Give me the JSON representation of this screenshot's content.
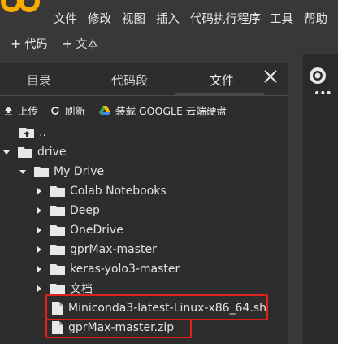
{
  "menu": [
    "文件",
    "修改",
    "视图",
    "插入",
    "代码执行程序",
    "工具",
    "帮助"
  ],
  "toolbar": {
    "add_code": "代码",
    "add_text": "文本"
  },
  "panel": {
    "tabs": [
      "目录",
      "代码段",
      "文件"
    ],
    "actions": {
      "upload": "上传",
      "refresh": "刷新",
      "mount_drive": "装载 GOOGLE 云端硬盘"
    },
    "tree": {
      "parent": "..",
      "drive": "drive",
      "mydrive": "My Drive",
      "folders": [
        "Colab Notebooks",
        "Deep",
        "OneDrive",
        "gprMax-master",
        "keras-yolo3-master",
        "文档"
      ],
      "files": [
        "Miniconda3-latest-Linux-x86_64.sh",
        "gprMax-master.zip"
      ]
    }
  },
  "colors": {
    "background": "#383838",
    "panel": "#2d2d2d",
    "highlight": "#e0201d",
    "logo": "#f9ab00"
  }
}
